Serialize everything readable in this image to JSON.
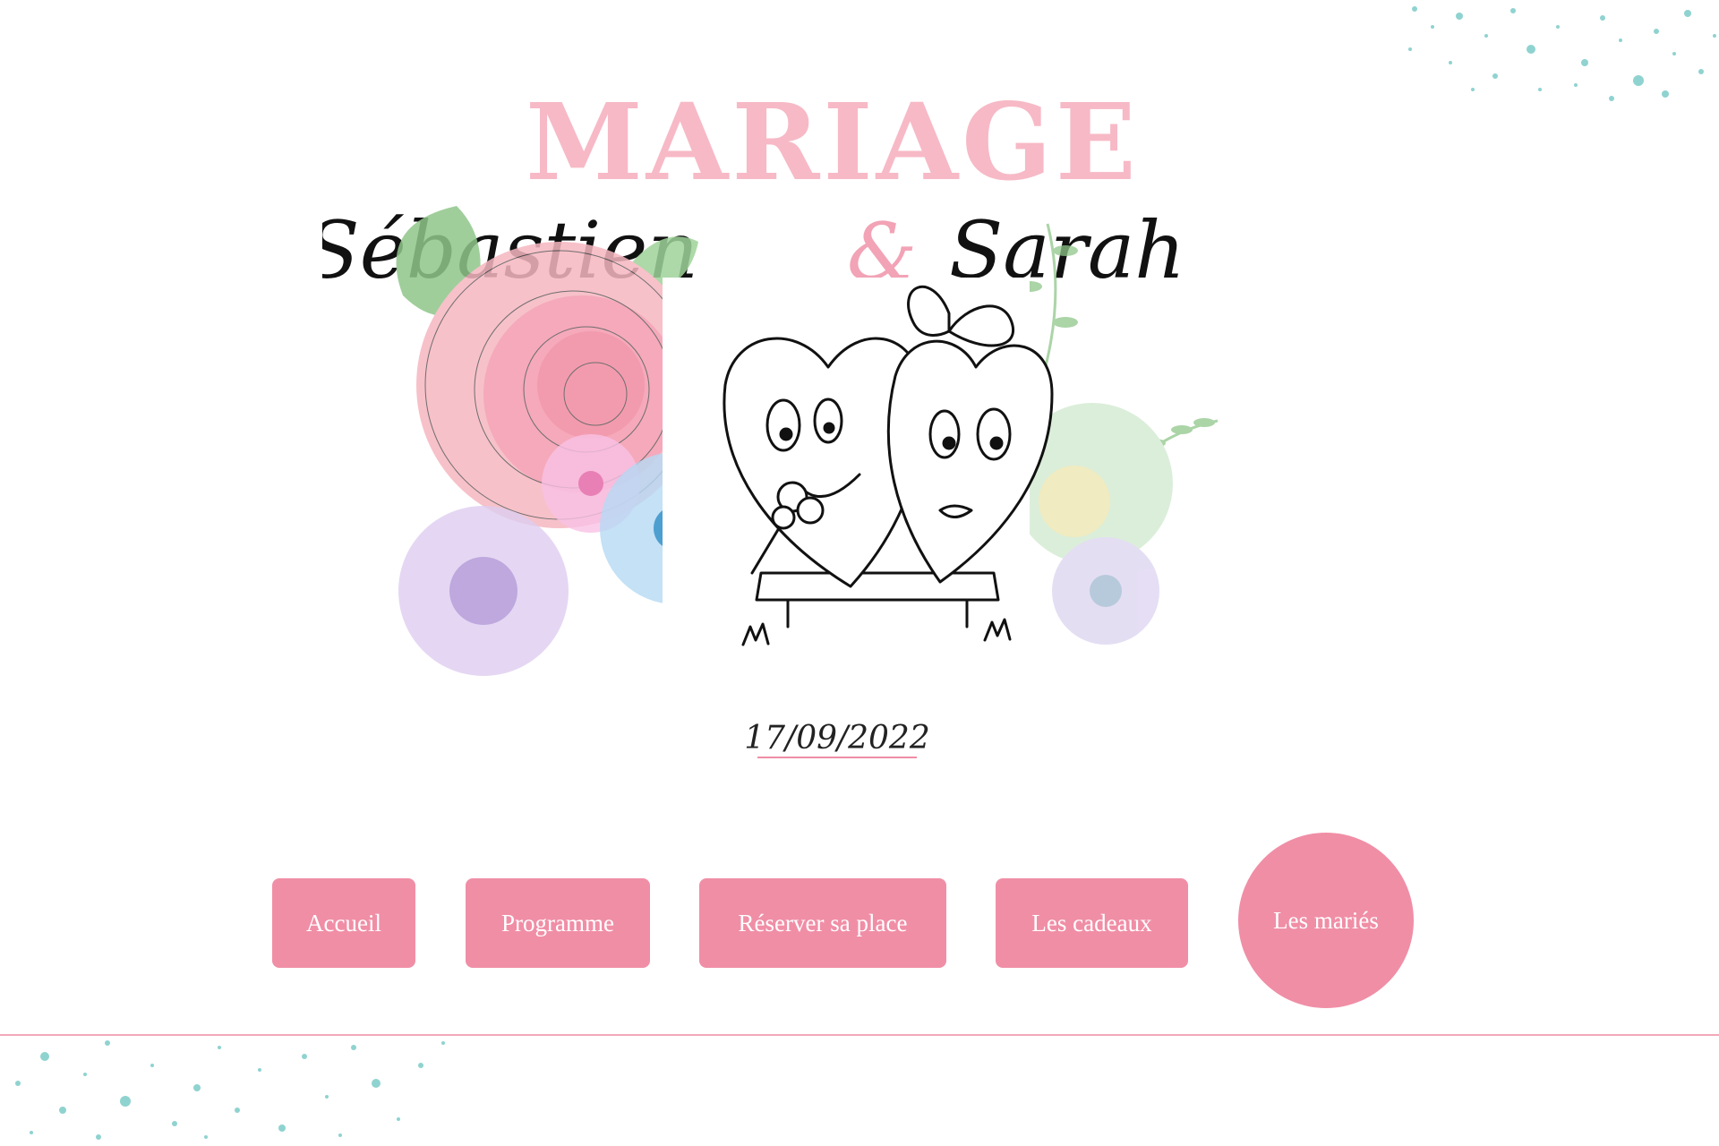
{
  "header": {
    "title": "MARIAGE",
    "groom": "Sébastien",
    "ampersand": "&",
    "bride": "Sarah"
  },
  "illustration": {
    "date": "17/09/2022"
  },
  "nav": {
    "items": [
      {
        "label": "Accueil"
      },
      {
        "label": "Programme"
      },
      {
        "label": "Réserver sa place"
      },
      {
        "label": "Les cadeaux"
      },
      {
        "label": "Les mariés"
      }
    ]
  },
  "colors": {
    "accent": "#f08ea6",
    "title_pink": "#f7b9c6",
    "splatter": "#7ecfcf",
    "divider": "#f2a9b9"
  }
}
